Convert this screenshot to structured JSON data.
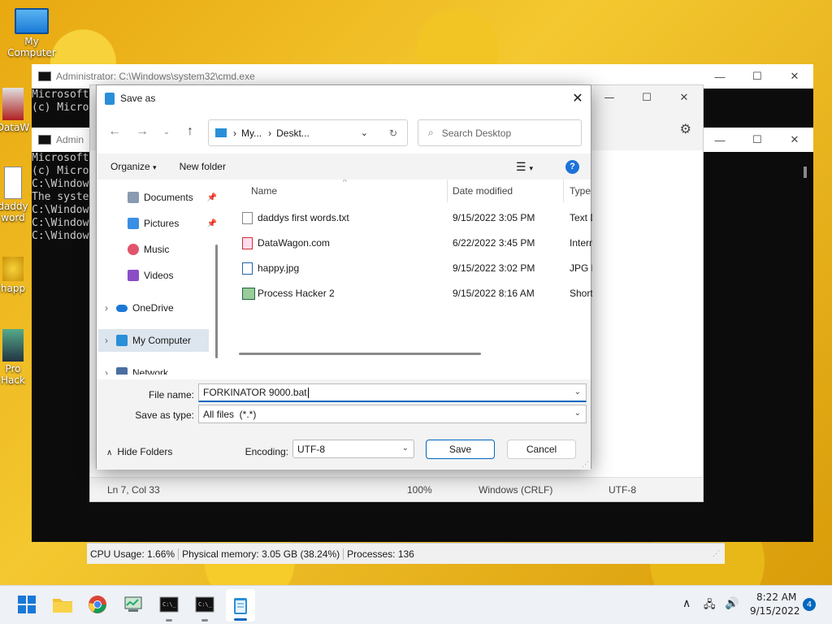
{
  "desktop": {
    "icons": [
      {
        "label": "My Computer"
      },
      {
        "label": "DataW"
      },
      {
        "label": "daddy\nword"
      },
      {
        "label": "happ"
      },
      {
        "label": "Pro\nHack"
      }
    ]
  },
  "cmd1": {
    "title": "Administrator: C:\\Windows\\system32\\cmd.exe",
    "lines": [
      "Microsoft",
      "(c) Micro"
    ]
  },
  "cmd2": {
    "title": "Admin",
    "lines": [
      "Microsoft",
      "(c) Micro",
      "",
      "C:\\Window",
      "The syste",
      "",
      "C:\\Window",
      "",
      "C:\\Window",
      "",
      "C:\\Window"
    ]
  },
  "notepad": {
    "status": {
      "position": "Ln 7, Col 33",
      "zoom": "100%",
      "line_ending": "Windows (CRLF)",
      "encoding": "UTF-8"
    }
  },
  "dialog": {
    "title": "Save as",
    "breadcrumb": [
      "My...",
      "Deskt..."
    ],
    "search_placeholder": "Search Desktop",
    "toolbar": {
      "organize": "Organize",
      "new_folder": "New folder"
    },
    "nav": [
      {
        "label": "Documents",
        "pinned": true,
        "color": "#8a9ab0"
      },
      {
        "label": "Pictures",
        "pinned": true,
        "color": "#3a8ee6"
      },
      {
        "label": "Music",
        "pinned": false,
        "color": "#e0556b"
      },
      {
        "label": "Videos",
        "pinned": false,
        "color": "#8a4fc7"
      },
      {
        "label": "OneDrive",
        "pinned": false,
        "color": "#1c78d4"
      },
      {
        "label": "My Computer",
        "pinned": false,
        "color": "#2a8fd8"
      },
      {
        "label": "Network",
        "pinned": false,
        "color": "#4a6fa0"
      }
    ],
    "columns": {
      "name": "Name",
      "date": "Date modified",
      "type": "Type"
    },
    "files": [
      {
        "name": "daddys first words.txt",
        "date": "9/15/2022 3:05 PM",
        "type": "Text D"
      },
      {
        "name": "DataWagon.com",
        "date": "6/22/2022 3:45 PM",
        "type": "Intern"
      },
      {
        "name": "happy.jpg",
        "date": "9/15/2022 3:02 PM",
        "type": "JPG F"
      },
      {
        "name": "Process Hacker 2",
        "date": "9/15/2022 8:16 AM",
        "type": "Short"
      }
    ],
    "file_name_label": "File name:",
    "file_name_value": "FORKINATOR 9000.bat",
    "save_type_label": "Save as type:",
    "save_type_value": "All files  (*.*)",
    "hide_folders": "Hide Folders",
    "encoding_label": "Encoding:",
    "encoding_value": "UTF-8",
    "save": "Save",
    "cancel": "Cancel"
  },
  "process_hacker": {
    "cpu": "CPU Usage: 1.66%",
    "memory": "Physical memory: 3.05 GB (38.24%)",
    "processes": "Processes: 136"
  },
  "taskbar": {
    "time": "8:22 AM",
    "date": "9/15/2022",
    "notifications": "4"
  },
  "colors": {
    "accent": "#0067c0",
    "taskbar": "#eef1f5"
  }
}
